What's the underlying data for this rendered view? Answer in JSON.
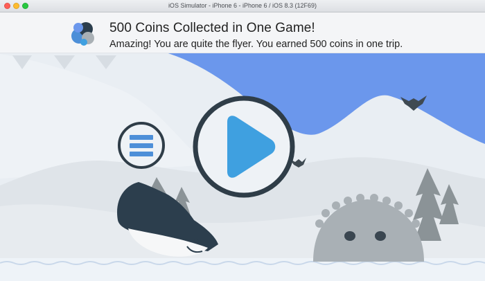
{
  "window": {
    "title": "iOS Simulator - iPhone 6 - iPhone 6 / iOS 8.3 (12F69)"
  },
  "notification": {
    "title": "500 Coins Collected in One Game!",
    "message": "Amazing! You are quite the flyer. You earned 500 coins in one trip.",
    "icon": "app-icon-bubbles"
  },
  "game": {
    "play_button_icon": "play-icon",
    "menu_button_icon": "hamburger-menu-icon"
  },
  "colors": {
    "sky_blue": "#6b97ec",
    "play_blue": "#3fa0e0",
    "ring_dark": "#2f3d48",
    "menu_blue": "#4d8fd8",
    "penguin_dark": "#2c3e4d",
    "hill_light": "#f2f5f8",
    "tree_gray": "#8b9397",
    "monster_gray": "#a9b0b5"
  }
}
